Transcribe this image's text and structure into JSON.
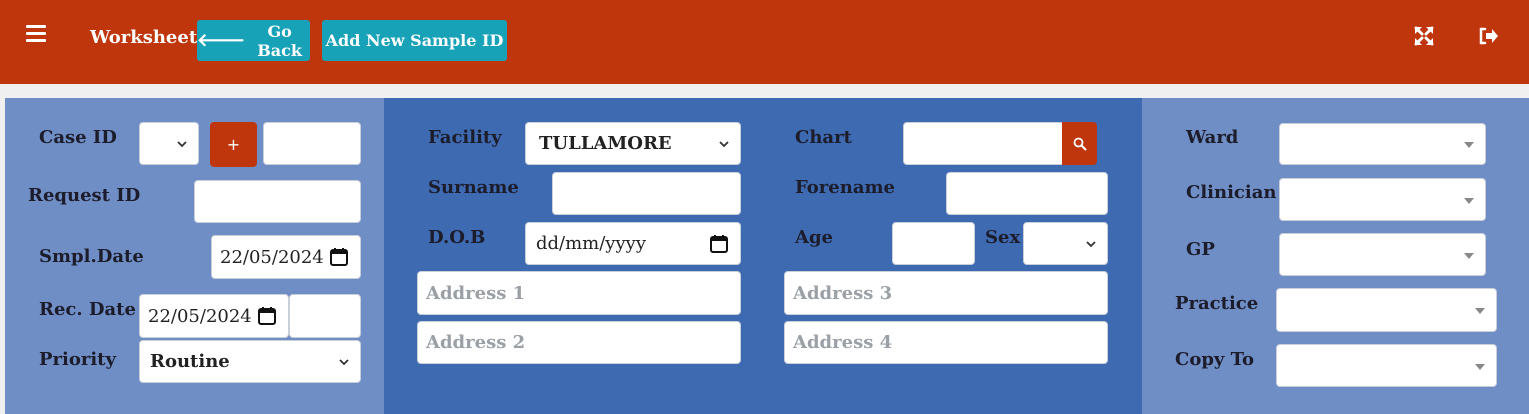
{
  "header": {
    "title": "Worksheet",
    "go_back_label": "Go Back",
    "add_sample_label": "Add New Sample ID",
    "icons": [
      "menu-icon",
      "arrow-left-icon",
      "fullscreen-icon",
      "logout-icon"
    ],
    "colors": {
      "topbar": "#bf350c",
      "button": "#17a2b8"
    }
  },
  "left": {
    "case_id_label": "Case ID",
    "case_id_select_value": "",
    "plus_label": "+",
    "case_id_value": "",
    "request_id_label": "Request ID",
    "request_id_value": "",
    "smpl_date_label": "Smpl.Date",
    "smpl_date_value": "22/05/2024",
    "rec_date_label": "Rec. Date",
    "rec_date_value": "22/05/2024",
    "rec_time_value": "",
    "priority_label": "Priority",
    "priority_value": "Routine"
  },
  "middle": {
    "facility_label": "Facility",
    "facility_value": "TULLAMORE",
    "surname_label": "Surname",
    "surname_value": "",
    "dob_label": "D.O.B",
    "dob_value": "dd/mm/yyyy",
    "address1_placeholder": "Address 1",
    "address2_placeholder": "Address 2",
    "chart_label": "Chart",
    "chart_value": "",
    "forename_label": "Forename",
    "forename_value": "",
    "age_label": "Age",
    "age_value": "",
    "sex_label": "Sex",
    "sex_value": "",
    "address3_placeholder": "Address 3",
    "address4_placeholder": "Address 4"
  },
  "right": {
    "ward_label": "Ward",
    "clinician_label": "Clinician",
    "gp_label": "GP",
    "practice_label": "Practice",
    "copy_to_label": "Copy To"
  }
}
